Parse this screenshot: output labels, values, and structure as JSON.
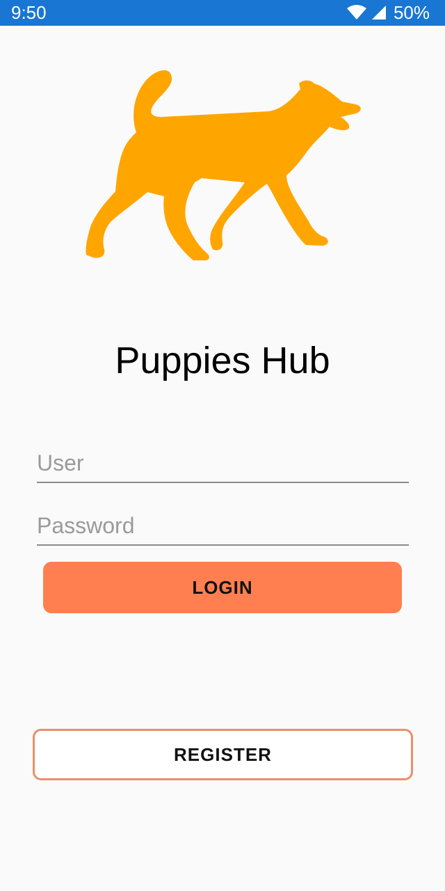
{
  "status_bar": {
    "time": "9:50",
    "battery": "50%",
    "icons": [
      "wifi-icon",
      "cellular-signal-icon"
    ],
    "background_color": "#1976d2"
  },
  "logo": {
    "icon": "dog-icon",
    "color": "#ffa500"
  },
  "app": {
    "title": "Puppies Hub"
  },
  "login_form": {
    "user_placeholder": "User",
    "user_value": "",
    "password_placeholder": "Password",
    "password_value": "",
    "login_label": "LOGIN",
    "login_color": "#ff7f50"
  },
  "register": {
    "label": "REGISTER",
    "border_color": "#e8906a"
  }
}
